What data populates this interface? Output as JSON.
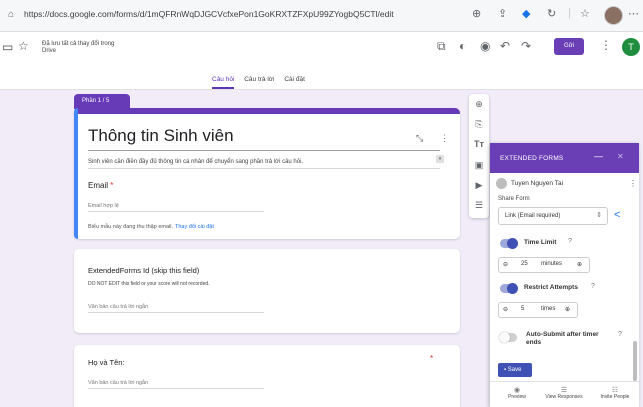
{
  "browser": {
    "url": "https://docs.google.com/forms/d/1mQFRnWqDJGCVcfxePon1GoKRXTZFXpU99ZYogbQ5CTl/edit",
    "icons": [
      "zoom-icon",
      "share-icon",
      "extension-icon",
      "reload-icon",
      "bookmark-icon"
    ]
  },
  "form_header": {
    "doc_title_line1": "Đã lưu tất cả thay đổi trong",
    "doc_title_line2": "Drive",
    "send_label": "Gửi",
    "user_initial": "T",
    "tabs": [
      {
        "label": "Câu hỏi",
        "active": true
      },
      {
        "label": "Câu trả lời",
        "active": false
      },
      {
        "label": "Cài đặt",
        "active": false
      }
    ]
  },
  "section": {
    "badge": "Phần 1 / 5"
  },
  "title_card": {
    "title": "Thông tin Sinh viên",
    "description": "Sinh viên cần điền đầy đủ thông tin cá nhân để chuyển sang phần trả lời câu hỏi.",
    "email_label": "Email",
    "email_placeholder": "Email hợp lệ",
    "email_note": "Biểu mẫu này đang thu thập email.",
    "email_note_link": "Thay đổi cài đặt"
  },
  "question_id": {
    "label": "ExtendedForms Id (skip this field)",
    "subtitle": "DO NOT EDIT this field or your score will not recorded.",
    "placeholder": "Văn bản câu trả lời ngắn"
  },
  "question_name": {
    "label": "Họ và Tên:",
    "required_mark": "*",
    "placeholder": "Văn bản câu trả lời ngắn"
  },
  "extended_forms": {
    "header_title": "EXTENDED FORMS",
    "minimize": "—",
    "close": "✕",
    "user_name": "Tuyen Nguyen Tai",
    "share_form_label": "Share Form",
    "share_option": "Link (Email required)",
    "time_limit_label": "Time Limit",
    "time_limit_on": true,
    "time_limit_value": "25",
    "time_limit_unit": "minutes",
    "restrict_label": "Restrict Attempts",
    "restrict_on": true,
    "restrict_value": "5",
    "restrict_unit": "times",
    "auto_submit_label_1": "Auto-Submit after timer",
    "auto_submit_label_2": "ends",
    "auto_submit_on": false,
    "save_label": "Save",
    "footer": [
      "Preview",
      "View Responses",
      "Invite People"
    ]
  }
}
